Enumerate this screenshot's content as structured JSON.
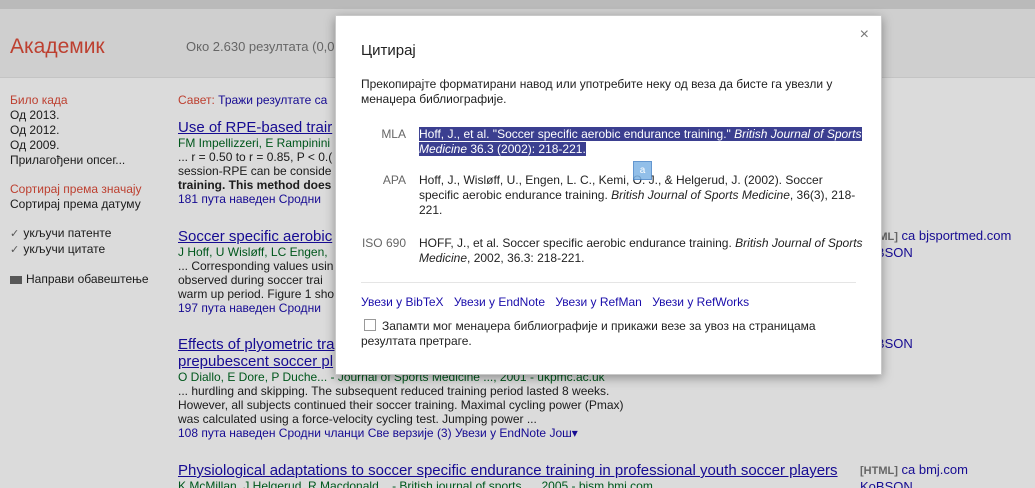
{
  "header": {
    "logo": "Академик",
    "results_count": "Око 2.630 резултата (0,03"
  },
  "sidebar": {
    "any_time": "Било када",
    "years": [
      "Од 2013.",
      "Од 2012.",
      "Од 2009."
    ],
    "custom_range": "Прилагођени опсег...",
    "sort_relevance": "Сортирај према значају",
    "sort_date": "Сортирај према датуму",
    "include_patents": "укључи патенте",
    "include_citations": "укључи цитате",
    "create_alert": "Направи обавештење"
  },
  "tip": {
    "prefix": "Савет:",
    "link": "Тражи резултате са"
  },
  "results": [
    {
      "title": "Use of RPE-based trair",
      "authors": "FM Impellizzeri, E Rampinini",
      "snippet": [
        "... r = 0.50 to r = 0.85, P < 0.(",
        "session-RPE can be conside",
        "training. This method does r"
      ],
      "links": "181 пута наведен   Сродни"
    },
    {
      "title": "Soccer specific aerobic",
      "authors": "J Hoff, U Wisløff, LC Engen,",
      "snippet": [
        "... Corresponding values usin",
        "observed during soccer trai",
        "warm up period. Figure 1 sho"
      ],
      "links": "197 пута наведен   Сродни",
      "side_tag": "[HTML]",
      "side_text": "са bjsportmed.com",
      "side_sub": "KoBSON"
    },
    {
      "title_line1": "Effects of plyometric tra",
      "title_line2": "prepubescent soccer pl",
      "authors": "O Diallo, E Dore, P Duche... - Journal of Sports Medicine ..., 2001 - ukpmc.ac.uk",
      "snippet": [
        "... hurdling and skipping. The subsequent reduced training period lasted 8 weeks.",
        "However, all subjects continued their soccer training. Maximal cycling power (Pmax)",
        "was calculated using a force-velocity cycling test. Jumping power ..."
      ],
      "links": "108 пута наведен   Сродни чланци   Све верзије (3)   Увези у EndNote   Још▾",
      "side_text": "KoBSON"
    },
    {
      "title": "Physiological adaptations to soccer specific endurance training in professional youth soccer players",
      "authors": "K McMillan, J Helgerud, R Macdonald... - British journal of sports ..., 2005 - bjsm.bmj.com",
      "side_tag": "[HTML]",
      "side_text": "са bmj.com",
      "side_sub": "KoBSON"
    }
  ],
  "modal": {
    "title": "Цитирај",
    "close": "×",
    "description": "Прекопирајте форматирани навод или употребите неку од веза да бисте га увезли у менаџера библиографије.",
    "formats": [
      {
        "label": "MLA",
        "text": "Hoff, J., et al. \"Soccer specific aerobic endurance training.\" British Journal of Sports Medicine 36.3 (2002): 218-221."
      },
      {
        "label": "APA",
        "text": "Hoff, J., Wisløff, U., Engen, L. C., Kemi, O. J., & Helgerud, J. (2002). Soccer specific aerobic endurance training. British Journal of Sports Medicine, 36(3), 218-221."
      },
      {
        "label": "ISO 690",
        "text": "HOFF, J., et al. Soccer specific aerobic endurance training. British Journal of Sports Medicine, 2002, 36.3: 218-221."
      }
    ],
    "imports": [
      "Увези у BibTeX",
      "Увези у EndNote",
      "Увези у RefMan",
      "Увези у RefWorks"
    ],
    "remember": "Запамти мог менаџера библиографије и прикажи везе за увоз на страницама резултата претраге."
  }
}
